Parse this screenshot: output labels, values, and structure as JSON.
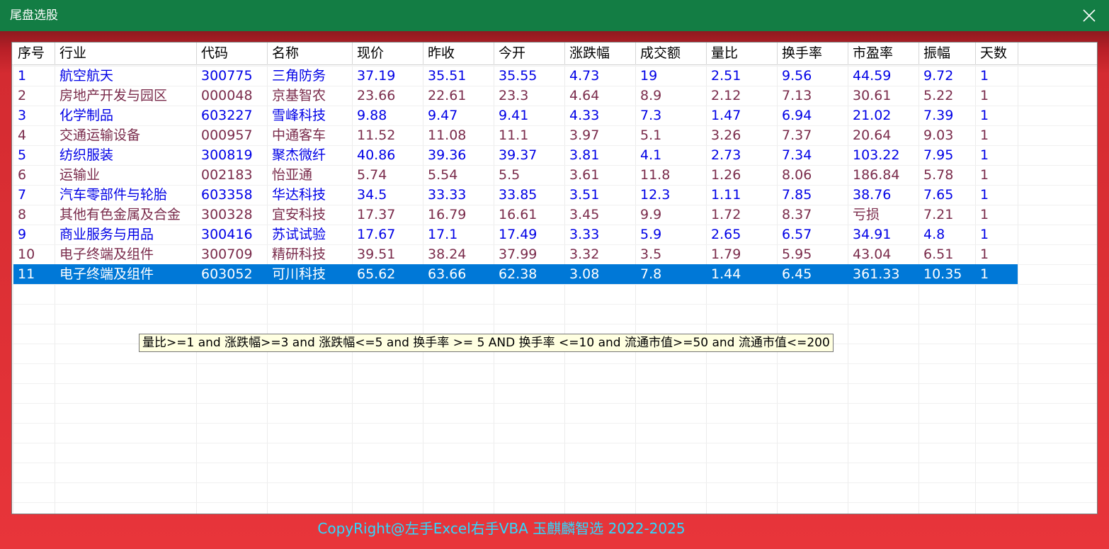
{
  "window": {
    "title": "尾盘选股",
    "title_bar_color": "#137d44",
    "frame_color": "#e02e33",
    "close_icon": "close-icon"
  },
  "table": {
    "columns": [
      "序号",
      "行业",
      "代码",
      "名称",
      "现价",
      "昨收",
      "今开",
      "涨跌幅",
      "成交额",
      "量比",
      "换手率",
      "市盈率",
      "振幅",
      "天数"
    ],
    "rows": [
      {
        "cells": [
          "1",
          "航空航天",
          "300775",
          "三角防务",
          "37.19",
          "35.51",
          "35.55",
          "4.73",
          "19",
          "2.51",
          "9.56",
          "44.59",
          "9.72",
          "1"
        ],
        "style": "blue"
      },
      {
        "cells": [
          "2",
          "房地产开发与园区",
          "000048",
          "京基智农",
          "23.66",
          "22.61",
          "23.3",
          "4.64",
          "8.9",
          "2.12",
          "7.13",
          "30.61",
          "5.22",
          "1"
        ],
        "style": "maroon"
      },
      {
        "cells": [
          "3",
          "化学制品",
          "603227",
          "雪峰科技",
          "9.88",
          "9.47",
          "9.41",
          "4.33",
          "7.3",
          "1.47",
          "6.94",
          "21.02",
          "7.39",
          "1"
        ],
        "style": "blue"
      },
      {
        "cells": [
          "4",
          "交通运输设备",
          "000957",
          "中通客车",
          "11.52",
          "11.08",
          "11.1",
          "3.97",
          "5.1",
          "3.26",
          "7.37",
          "20.64",
          "9.03",
          "1"
        ],
        "style": "maroon"
      },
      {
        "cells": [
          "5",
          "纺织服装",
          "300819",
          "聚杰微纤",
          "40.86",
          "39.36",
          "39.37",
          "3.81",
          "4.1",
          "2.73",
          "7.34",
          "103.22",
          "7.95",
          "1"
        ],
        "style": "blue"
      },
      {
        "cells": [
          "6",
          "运输业",
          "002183",
          "怡亚通",
          "5.74",
          "5.54",
          "5.5",
          "3.61",
          "11.8",
          "1.26",
          "8.06",
          "186.84",
          "5.78",
          "1"
        ],
        "style": "maroon"
      },
      {
        "cells": [
          "7",
          "汽车零部件与轮胎",
          "603358",
          "华达科技",
          "34.5",
          "33.33",
          "33.85",
          "3.51",
          "12.3",
          "1.11",
          "7.85",
          "38.76",
          "7.65",
          "1"
        ],
        "style": "blue"
      },
      {
        "cells": [
          "8",
          "其他有色金属及合金",
          "300328",
          "宜安科技",
          "17.37",
          "16.79",
          "16.61",
          "3.45",
          "9.9",
          "1.72",
          "8.37",
          "亏损",
          "7.21",
          "1"
        ],
        "style": "maroon"
      },
      {
        "cells": [
          "9",
          "商业服务与用品",
          "300416",
          "苏试试验",
          "17.67",
          "17.1",
          "17.49",
          "3.33",
          "5.9",
          "2.65",
          "6.57",
          "34.91",
          "4.8",
          "1"
        ],
        "style": "blue"
      },
      {
        "cells": [
          "10",
          "电子终端及组件",
          "300709",
          "精研科技",
          "39.51",
          "38.24",
          "37.99",
          "3.32",
          "3.5",
          "1.79",
          "5.95",
          "43.04",
          "6.51",
          "1"
        ],
        "style": "maroon"
      },
      {
        "cells": [
          "11",
          "电子终端及组件",
          "603052",
          "可川科技",
          "65.62",
          "63.66",
          "62.38",
          "3.08",
          "7.8",
          "1.44",
          "6.45",
          "361.33",
          "10.35",
          "1"
        ],
        "style": "selected"
      }
    ],
    "colors": {
      "blue_text": "#0000e6",
      "maroon_text": "#7a2b4b",
      "selected_bg": "#0078d7"
    }
  },
  "tooltip": "量比>=1 and 涨跌幅>=3 and 涨跌幅<=5 and 换手率 >= 5 AND 换手率 <=10 and 流通市值>=50 and 流通市值<=200",
  "footer": {
    "copyright": "CopyRight@左手Excel右手VBA 玉麒麟智选  2022-2025",
    "color": "#2ed9ff"
  }
}
